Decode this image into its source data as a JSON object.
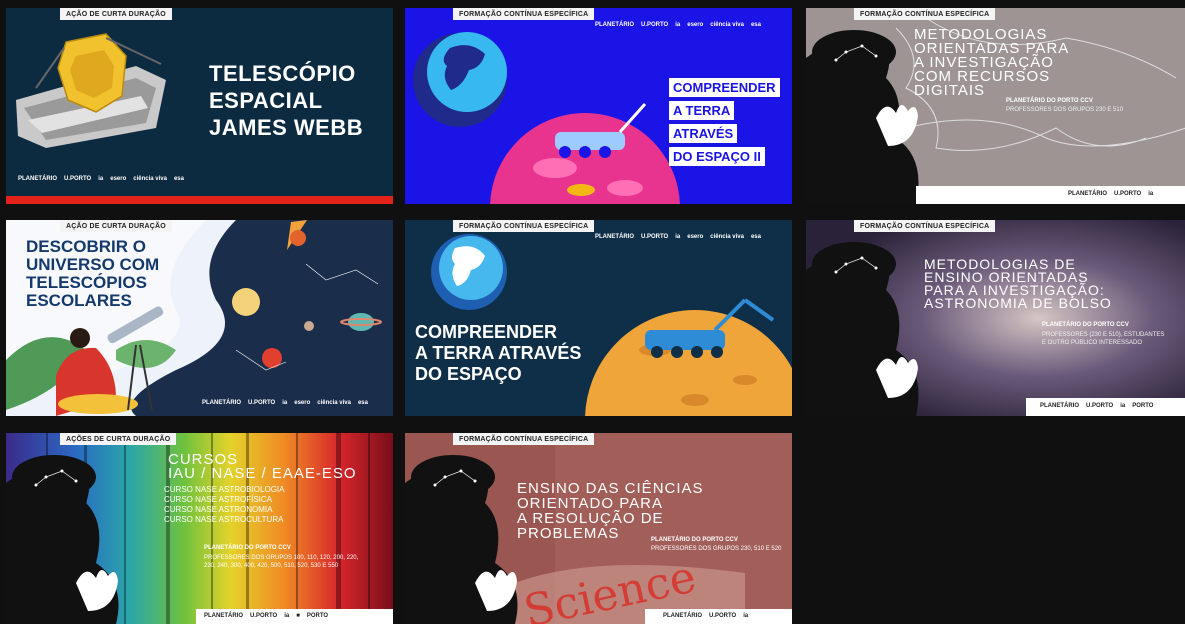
{
  "cards": [
    {
      "tag": "AÇÃO DE CURTA DURAÇÃO",
      "title": "TELESCÓPIO\nESPACIAL\nJAMES WEBB",
      "logos": [
        "PLANETÁRIO",
        "U.PORTO",
        "ia",
        "esero",
        "ciência viva",
        "esa"
      ]
    },
    {
      "tag": "FORMAÇÃO CONTÍNUA ESPECÍFICA",
      "title_lines": [
        "COMPREENDER",
        "A TERRA",
        "ATRAVÉS",
        "DO ESPAÇO II"
      ],
      "logos": [
        "PLANETÁRIO",
        "U.PORTO",
        "ia",
        "esero",
        "ciência viva",
        "esa"
      ]
    },
    {
      "tag": "FORMAÇÃO CONTÍNUA ESPECÍFICA",
      "title": "METODOLOGIAS\nORIENTADAS PARA\nA INVESTIGAÇÃO\nCOM RECURSOS\nDIGITAIS",
      "org": "PLANETÁRIO DO PORTO CCV",
      "audience": "PROFESSORES DOS GRUPOS 230 E 510",
      "logos": [
        "PLANETÁRIO",
        "U.PORTO",
        "ia"
      ]
    },
    {
      "tag": "AÇÃO DE CURTA DURAÇÃO",
      "title": "DESCOBRIR O\nUNIVERSO COM\nTELESCÓPIOS\nESCOLARES",
      "logos": [
        "PLANETÁRIO",
        "U.PORTO",
        "ia",
        "esero",
        "ciência viva",
        "esa"
      ]
    },
    {
      "tag": "FORMAÇÃO CONTÍNUA ESPECÍFICA",
      "title": "COMPREENDER\nA TERRA ATRAVÉS\nDO ESPAÇO",
      "logos": [
        "PLANETÁRIO",
        "U.PORTO",
        "ia",
        "esero",
        "ciência viva",
        "esa"
      ]
    },
    {
      "tag": "FORMAÇÃO CONTÍNUA ESPECÍFICA",
      "title": "METODOLOGIAS DE\nENSINO ORIENTADAS\nPARA A INVESTIGAÇÃO:\nASTRONOMIA DE BOLSO",
      "org": "PLANETÁRIO DO PORTO CCV",
      "audience": "PROFESSORES (230 E 510), ESTUDANTES\nE OUTRO PÚBLICO INTERESSADO",
      "logos": [
        "PLANETÁRIO",
        "U.PORTO",
        "ia",
        "PORTO"
      ]
    },
    {
      "tag": "AÇÕES DE CURTA DURAÇÃO",
      "title": "CURSOS\nIAU / NASE / EAAE-ESO",
      "courses": [
        "CURSO NASE ASTROBIOLOGIA",
        "CURSO NASE ASTROFÍSICA",
        "CURSO NASE ASTRONOMIA",
        "CURSO NASE ASTROCULTURA"
      ],
      "org": "PLANETÁRIO DO PORTO CCV",
      "audience": "PROFESSORES DOS GRUPOS 100, 110, 120, 200, 220,\n230, 240, 300, 400, 420, 500, 510, 520, 530 E 550",
      "logos": [
        "PLANETÁRIO",
        "U.PORTO",
        "ia",
        "■",
        "PORTO"
      ]
    },
    {
      "tag": "FORMAÇÃO CONTÍNUA ESPECÍFICA",
      "title": "ENSINO DAS CIÊNCIAS\nORIENTADO PARA\nA RESOLUÇÃO DE\nPROBLEMAS",
      "org": "PLANETÁRIO DO PORTO CCV",
      "audience": "PROFESSORES DOS GRUPOS 230, 510 E 520",
      "scene_word": "Science",
      "logos": [
        "PLANETÁRIO",
        "U.PORTO",
        "ia"
      ]
    }
  ]
}
